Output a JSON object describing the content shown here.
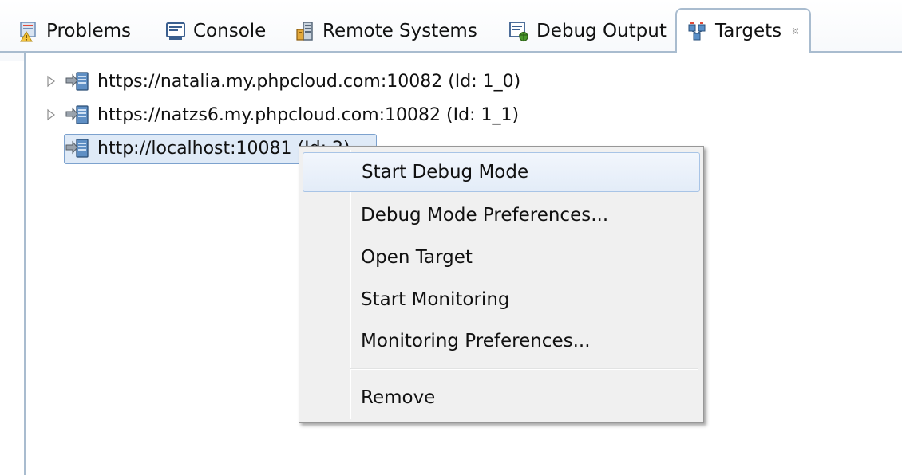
{
  "tabs": [
    {
      "label": "Problems",
      "icon": "problems-icon",
      "active": false
    },
    {
      "label": "Console",
      "icon": "console-icon",
      "active": false
    },
    {
      "label": "Remote Systems",
      "icon": "remote-systems-icon",
      "active": false
    },
    {
      "label": "Debug Output",
      "icon": "debug-output-icon",
      "active": false
    },
    {
      "label": "Targets",
      "icon": "targets-icon",
      "active": true
    }
  ],
  "tree": {
    "items": [
      {
        "label": "https://natalia.my.phpcloud.com:10082 (Id: 1_0)",
        "expandable": true,
        "icon": "server-target-icon"
      },
      {
        "label": "https://natzs6.my.phpcloud.com:10082 (Id: 1_1)",
        "expandable": true,
        "icon": "server-target-icon"
      },
      {
        "label": "http://localhost:10081 (Id: 2)",
        "expandable": false,
        "selected": true,
        "icon": "server-target-icon"
      }
    ]
  },
  "context_menu": {
    "items": [
      {
        "label": "Start Debug Mode",
        "highlighted": true
      },
      {
        "label": "Debug Mode Preferences..."
      },
      {
        "label": "Open Target"
      },
      {
        "label": "Start Monitoring"
      },
      {
        "label": "Monitoring Preferences..."
      },
      {
        "label": "Remove"
      }
    ]
  },
  "colors": {
    "tab_border": "#a9bccf",
    "selection_border": "#7da2ce",
    "selection_fill": "#dfeaf7",
    "menu_background": "#f0f0f0",
    "menu_highlight_border": "#a8c4e6"
  }
}
